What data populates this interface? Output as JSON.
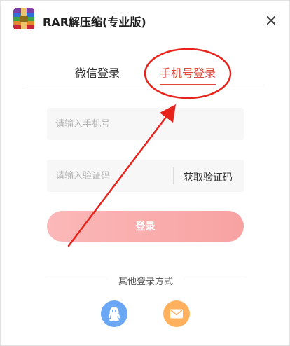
{
  "window": {
    "title": "RAR解压缩(专业版)",
    "logo_icon": "winrar-books-icon",
    "close_icon": "close-icon"
  },
  "tabs": [
    {
      "label": "微信登录",
      "active": false
    },
    {
      "label": "手机号登录",
      "active": true
    }
  ],
  "form": {
    "phone_placeholder": "请输入手机号",
    "phone_value": "",
    "code_placeholder": "请输入验证码",
    "code_value": "",
    "get_code_label": "获取验证码",
    "login_label": "登录"
  },
  "other_login": {
    "label": "其他登录方式",
    "options": [
      {
        "icon": "qq-penguin-icon",
        "color": "#6aa8f5"
      },
      {
        "icon": "email-envelope-icon",
        "color": "#ffb15e"
      }
    ]
  },
  "colors": {
    "accent": "#e0483c",
    "login_button_start": "#fbb8b8",
    "login_button_end": "#f8a2a2",
    "annotation": "#e8231c"
  }
}
